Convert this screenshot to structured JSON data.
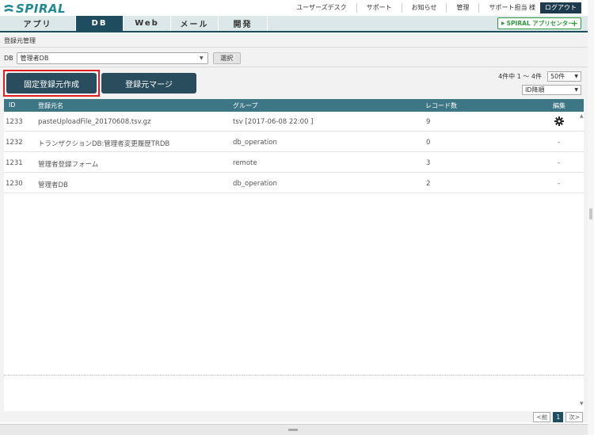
{
  "header": {
    "logo_text": "SPIRAL",
    "links": [
      "ユーザーズデスク",
      "サポート",
      "お知らせ",
      "管理"
    ],
    "user": "サポート担当 様",
    "logout": "ログアウト"
  },
  "nav": {
    "tabs": [
      {
        "label": "アプリ",
        "active": false
      },
      {
        "label": "DB",
        "active": true
      },
      {
        "label": "Web",
        "active": false
      },
      {
        "label": "メール",
        "active": false
      },
      {
        "label": "開発",
        "active": false
      }
    ],
    "appcenter": "SPIRAL アプリセンター"
  },
  "page": {
    "title": "登録元管理",
    "db_label": "DB",
    "db_selected": "管理者DB",
    "select_button": "選択",
    "buttons": {
      "fixed_create": "固定登録元作成",
      "merge": "登録元マージ"
    },
    "count_text": "4件中 1 ～ 4件",
    "per_page": "50件",
    "sort": "ID降順"
  },
  "table": {
    "headers": [
      "ID",
      "登録元名",
      "グループ",
      "レコード数",
      "編集"
    ],
    "rows": [
      {
        "id": "1233",
        "name": "pasteUploadFile_20170608.tsv.gz",
        "group": "tsv [2017-06-08 22:00 ]",
        "records": "9",
        "edit": ""
      },
      {
        "id": "1232",
        "name": "トランザクションDB:管理者変更履歴TRDB",
        "group": "db_operation",
        "records": "0",
        "edit": "-"
      },
      {
        "id": "1231",
        "name": "管理者登録フォーム",
        "group": "remote",
        "records": "3",
        "edit": "-"
      },
      {
        "id": "1230",
        "name": "管理者DB",
        "group": "db_operation",
        "records": "2",
        "edit": "-"
      }
    ]
  },
  "pagination": {
    "prev": "<前",
    "current": "1",
    "next": "次>"
  },
  "colors": {
    "brand": "#1f8a94",
    "nav_active": "#1d4d5e",
    "table_header": "#3d7685",
    "highlight": "#e02020",
    "appcenter": "#2f9a3f"
  }
}
